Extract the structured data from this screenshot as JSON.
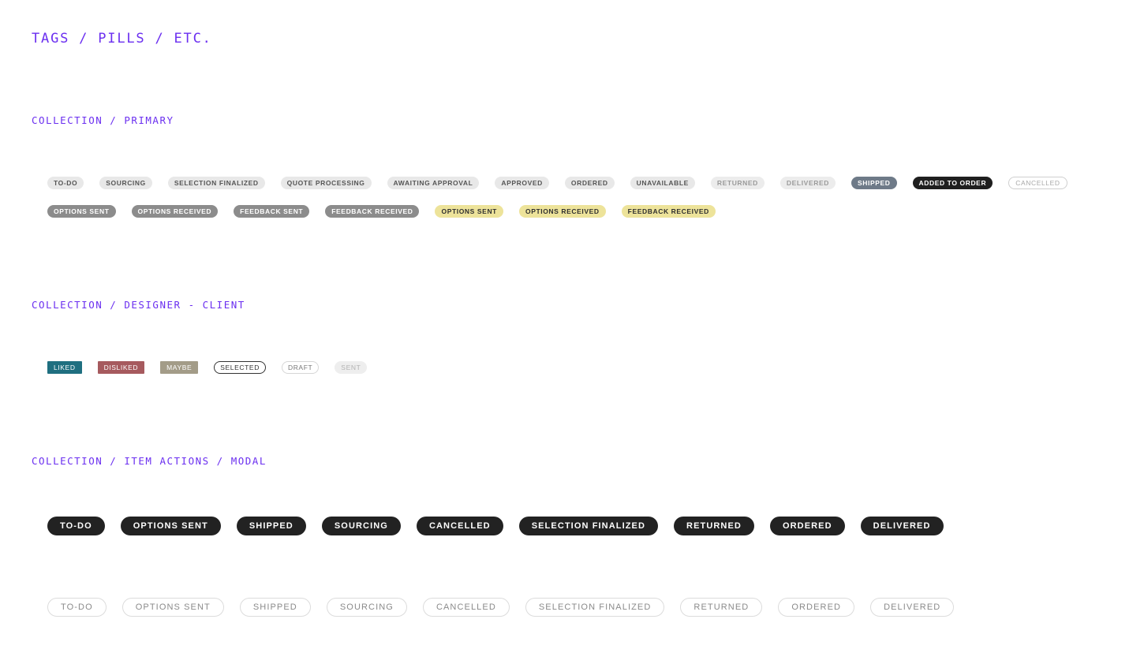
{
  "title": "TAGS / PILLS / ETC.",
  "sections": {
    "primary": {
      "heading": "COLLECTION / PRIMARY",
      "row1": [
        {
          "label": "TO-DO",
          "style": "light"
        },
        {
          "label": "SOURCING",
          "style": "light"
        },
        {
          "label": "SELECTION FINALIZED",
          "style": "light"
        },
        {
          "label": "QUOTE PROCESSING",
          "style": "light"
        },
        {
          "label": "AWAITING APPROVAL",
          "style": "light"
        },
        {
          "label": "APPROVED",
          "style": "light"
        },
        {
          "label": "ORDERED",
          "style": "light"
        },
        {
          "label": "UNAVAILABLE",
          "style": "light"
        },
        {
          "label": "RETURNED",
          "style": "faded"
        },
        {
          "label": "DELIVERED",
          "style": "faded"
        },
        {
          "label": "SHIPPED",
          "style": "slate"
        },
        {
          "label": "ADDED TO ORDER",
          "style": "black"
        },
        {
          "label": "CANCELLED",
          "style": "outline"
        }
      ],
      "row2": [
        {
          "label": "OPTIONS SENT",
          "style": "grey"
        },
        {
          "label": "OPTIONS RECEIVED",
          "style": "grey"
        },
        {
          "label": "FEEDBACK SENT",
          "style": "grey"
        },
        {
          "label": "FEEDBACK RECEIVED",
          "style": "grey"
        },
        {
          "label": "OPTIONS SENT",
          "style": "yellow"
        },
        {
          "label": "OPTIONS RECEIVED",
          "style": "yellow"
        },
        {
          "label": "FEEDBACK RECEIVED",
          "style": "yellow"
        }
      ]
    },
    "designer_client": {
      "heading": "COLLECTION / DESIGNER - CLIENT",
      "tags": [
        {
          "label": "LIKED",
          "style": "liked"
        },
        {
          "label": "DISLIKED",
          "style": "disliked"
        },
        {
          "label": "MAYBE",
          "style": "maybe"
        },
        {
          "label": "SELECTED",
          "style": "selected"
        },
        {
          "label": "DRAFT",
          "style": "draft"
        },
        {
          "label": "SENT",
          "style": "sent"
        }
      ]
    },
    "item_actions": {
      "heading": "COLLECTION / ITEM ACTIONS / MODAL",
      "dark": [
        "TO-DO",
        "OPTIONS SENT",
        "SHIPPED",
        "SOURCING",
        "CANCELLED",
        "SELECTION FINALIZED",
        "RETURNED",
        "ORDERED",
        "DELIVERED"
      ],
      "outline": [
        "TO-DO",
        "OPTIONS SENT",
        "SHIPPED",
        "SOURCING",
        "CANCELLED",
        "SELECTION FINALIZED",
        "RETURNED",
        "ORDERED",
        "DELIVERED"
      ]
    }
  },
  "colors": {
    "heading": "#6b2ff0",
    "slate": "#6e7a88",
    "black": "#1f1f1f",
    "grey": "#8c8c8c",
    "yellow": "#ede39a",
    "liked": "#1f6f80",
    "disliked": "#a65a5e",
    "maybe": "#a39c88"
  }
}
